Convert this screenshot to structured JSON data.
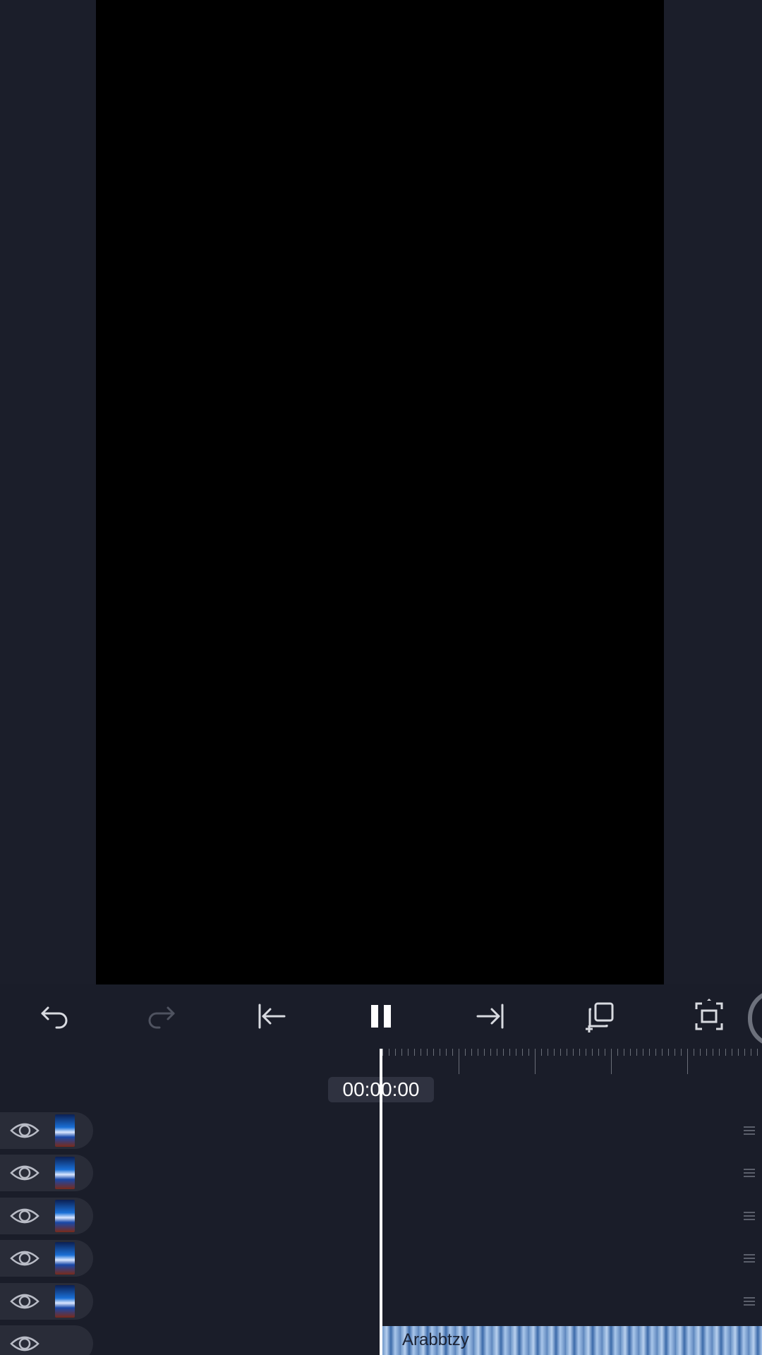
{
  "editor": {
    "timecode": "00:00:00",
    "toolbar": [
      {
        "name": "undo-button",
        "icon": "undo-icon",
        "enabled": true
      },
      {
        "name": "redo-button",
        "icon": "redo-icon",
        "enabled": false
      },
      {
        "name": "jump-to-start-button",
        "icon": "jump-to-start-icon",
        "enabled": true
      },
      {
        "name": "pause-button",
        "icon": "pause-icon",
        "enabled": true
      },
      {
        "name": "jump-to-end-button",
        "icon": "jump-to-end-icon",
        "enabled": true
      },
      {
        "name": "add-layer-button",
        "icon": "duplicate-add-icon",
        "enabled": true
      },
      {
        "name": "fullscreen-button",
        "icon": "fullscreen-icon",
        "enabled": true
      }
    ],
    "layers": [
      {
        "visible": true,
        "icon": "eye-icon",
        "thumbnail": "clip-thumbnail"
      },
      {
        "visible": true,
        "icon": "eye-icon",
        "thumbnail": "clip-thumbnail"
      },
      {
        "visible": true,
        "icon": "eye-icon",
        "thumbnail": "clip-thumbnail"
      },
      {
        "visible": true,
        "icon": "eye-icon",
        "thumbnail": "clip-thumbnail"
      },
      {
        "visible": true,
        "icon": "eye-icon",
        "thumbnail": "clip-thumbnail"
      },
      {
        "visible": true,
        "icon": "eye-icon",
        "thumbnail": null
      }
    ],
    "audio_clip": {
      "label": "Arabbtzy"
    }
  },
  "colors": {
    "background": "#1a1d29",
    "preview": "#000000",
    "layer_head": "#292c38",
    "icon": "#d8dae0",
    "icon_disabled": "#4f5360",
    "playhead": "#ffffff",
    "audio_clip": "#7fa3d3"
  }
}
